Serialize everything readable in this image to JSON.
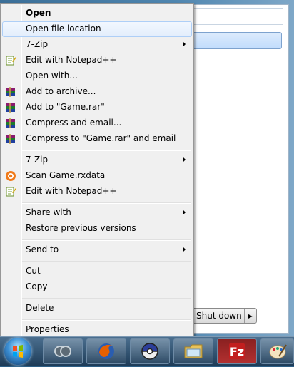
{
  "menu": {
    "items": [
      {
        "label": "Open",
        "bold": true,
        "submenu": false,
        "icon": ""
      },
      {
        "label": "Open file location",
        "bold": false,
        "submenu": false,
        "icon": "",
        "hover": true
      },
      {
        "label": "7-Zip",
        "bold": false,
        "submenu": true,
        "icon": ""
      },
      {
        "label": "Edit with Notepad++",
        "bold": false,
        "submenu": false,
        "icon": "notepadpp-icon"
      },
      {
        "label": "Open with...",
        "bold": false,
        "submenu": false,
        "icon": ""
      },
      {
        "label": "Add to archive...",
        "bold": false,
        "submenu": false,
        "icon": "winrar-icon"
      },
      {
        "label": "Add to \"Game.rar\"",
        "bold": false,
        "submenu": false,
        "icon": "winrar-icon"
      },
      {
        "label": "Compress and email...",
        "bold": false,
        "submenu": false,
        "icon": "winrar-icon"
      },
      {
        "label": "Compress to \"Game.rar\" and email",
        "bold": false,
        "submenu": false,
        "icon": "winrar-icon"
      },
      {
        "label": "7-Zip",
        "bold": false,
        "submenu": true,
        "icon": ""
      },
      {
        "label": "Scan Game.rxdata",
        "bold": false,
        "submenu": false,
        "icon": "avast-icon"
      },
      {
        "label": "Edit with Notepad++",
        "bold": false,
        "submenu": false,
        "icon": "notepadpp-icon"
      },
      {
        "label": "Share with",
        "bold": false,
        "submenu": true,
        "icon": ""
      },
      {
        "label": "Restore previous versions",
        "bold": false,
        "submenu": false,
        "icon": ""
      },
      {
        "label": "Send to",
        "bold": false,
        "submenu": true,
        "icon": ""
      },
      {
        "label": "Cut",
        "bold": false,
        "submenu": false,
        "icon": ""
      },
      {
        "label": "Copy",
        "bold": false,
        "submenu": false,
        "icon": ""
      },
      {
        "label": "Delete",
        "bold": false,
        "submenu": false,
        "icon": ""
      },
      {
        "label": "Properties",
        "bold": false,
        "submenu": false,
        "icon": ""
      }
    ]
  },
  "start_menu": {
    "shutdown_label": "Shut down"
  },
  "taskbar": {
    "buttons": [
      "windows-start-icon",
      "app-icon",
      "firefox-icon",
      "pokeball-icon",
      "file-explorer-icon",
      "filezilla-icon",
      "paint-icon"
    ]
  }
}
